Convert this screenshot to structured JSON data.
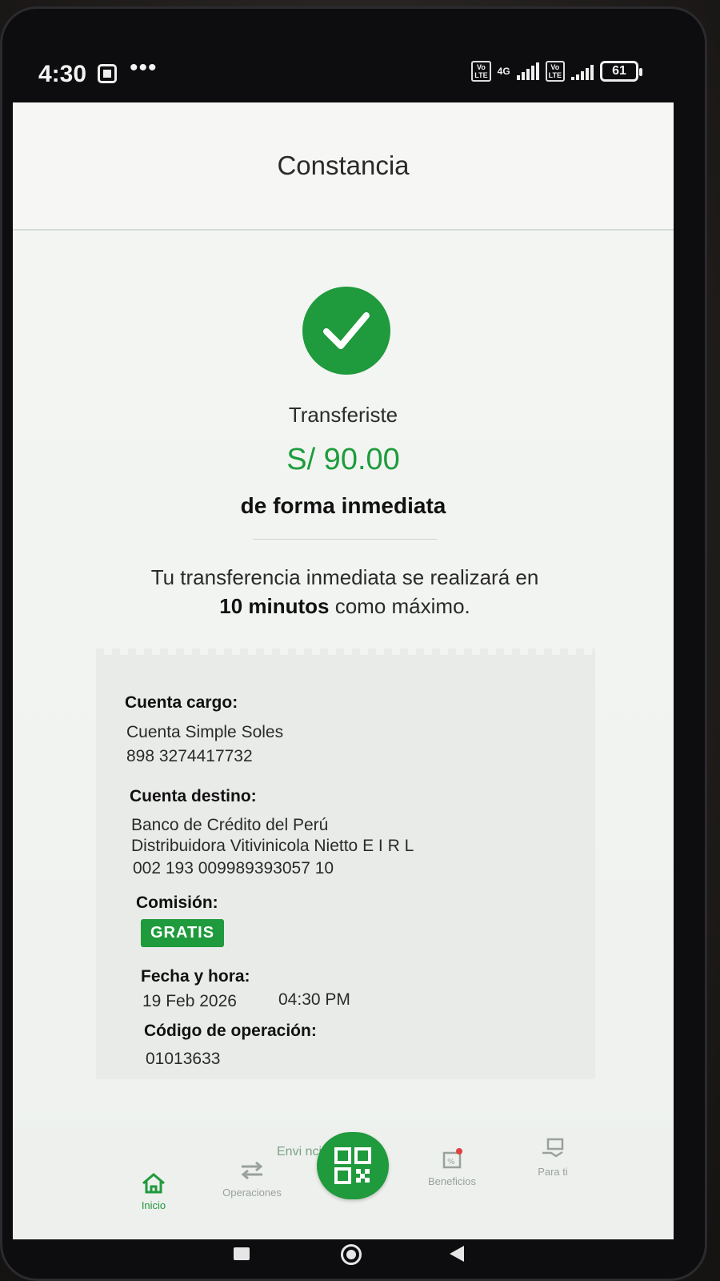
{
  "status_bar": {
    "time": "4:30",
    "volte1": "Vo\nLTE",
    "network": "4G",
    "volte2": "Vo\nLTE",
    "battery": "61"
  },
  "header": {
    "title": "Constancia"
  },
  "success": {
    "label": "Transferiste",
    "amount": "S/ 90.00",
    "mode": "de forma inmediata",
    "accent_color": "#1f9a3c"
  },
  "info": {
    "line1": "Tu transferencia inmediata se realizará en",
    "line2_bold": "10 minutos",
    "line2_rest": " como máximo."
  },
  "receipt": {
    "cuenta_cargo_title": "Cuenta cargo:",
    "cuenta_cargo_name": "Cuenta Simple Soles",
    "cuenta_cargo_number": "898 3274417732",
    "cuenta_destino_title": "Cuenta destino:",
    "cuenta_destino_bank": "Banco de Crédito del Perú",
    "cuenta_destino_name": "Distribuidora Vitivinicola Nietto E I R L",
    "cuenta_destino_number": "002 193 009989393057 10",
    "comision_title": "Comisión:",
    "comision_value": "GRATIS",
    "fecha_title": "Fecha y hora:",
    "fecha_date": "19 Feb 2026",
    "fecha_time": "04:30 PM",
    "codigo_title": "Código de operación:",
    "codigo_value": "01013633"
  },
  "bottom": {
    "share_label": "Envi    ncia",
    "tabs": [
      {
        "label": "Inicio",
        "icon": "home-icon"
      },
      {
        "label": "Operaciones",
        "icon": "transfer-arrows-icon"
      },
      {
        "label": "Beneficios",
        "icon": "gift-icon"
      },
      {
        "label": "Para ti",
        "icon": "hand-card-icon"
      }
    ],
    "fab_icon": "qr-code-icon"
  }
}
